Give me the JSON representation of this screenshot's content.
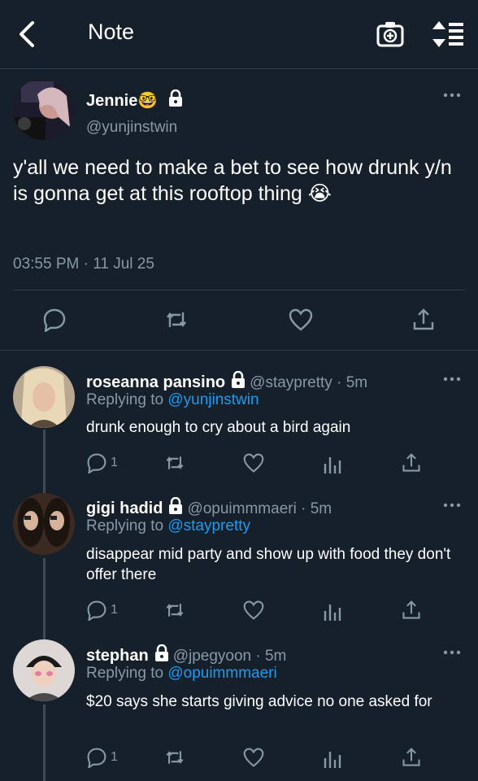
{
  "header": {
    "title": "Note",
    "icons": [
      "back-arrow-icon",
      "camera-plus-icon",
      "sort-icon"
    ]
  },
  "tweet": {
    "name": "Jennie",
    "name_emoji": "🤓",
    "handle": "@yunjinstwin",
    "text": "y'all we need to make a bet to see how drunk y/n is gonna get at this rooftop thing 😭",
    "timestamp": "03:55 PM · 11 Jul 25"
  },
  "replies": [
    {
      "name": "roseanna pansino",
      "handle": "@staypretty · 5m",
      "replying_label": "Replying to",
      "replying_to": "@yunjinstwin",
      "text": "drunk enough to cry about a bird again",
      "reply_count": "1"
    },
    {
      "name": "gigi hadid",
      "handle": "@opuimmmaeri · 5m",
      "replying_label": "Replying to",
      "replying_to": "@staypretty",
      "text": "disappear mid party and show up with food they don't offer there",
      "reply_count": "1"
    },
    {
      "name": "stephan",
      "handle": "@jpegyoon · 5m",
      "replying_label": "Replying to",
      "replying_to": "@opuimmmaeri",
      "text": "$20 says she starts giving advice no one asked for",
      "reply_count": "1"
    }
  ],
  "colors": {
    "background": "#15202b",
    "secondary_text": "#8899a6",
    "link": "#1d9bf0",
    "divider": "#2f3d4a"
  }
}
